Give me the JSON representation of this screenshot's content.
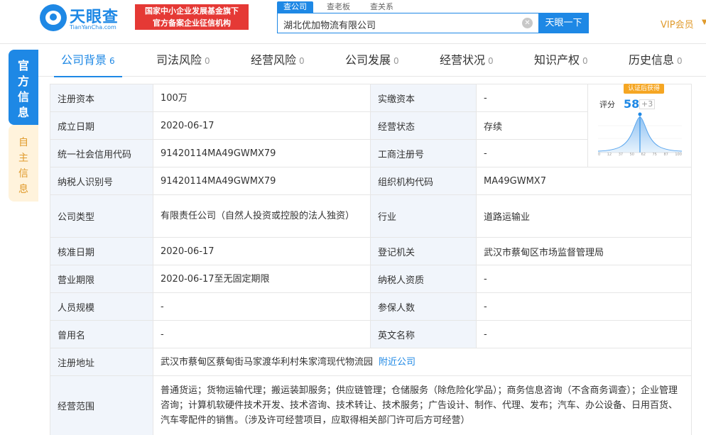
{
  "header": {
    "logo_cn": "天眼查",
    "logo_en": "TianYanCha.com",
    "slogan_line1": "国家中小企业发展基金旗下",
    "slogan_line2": "官方备案企业征信机构",
    "search_tabs": [
      "查公司",
      "查老板",
      "查关系"
    ],
    "search_value": "湖北优加物流有限公司",
    "search_button": "天眼一下",
    "vip": "VIP会员"
  },
  "side_tabs": {
    "official": [
      "官",
      "方",
      "信",
      "息"
    ],
    "self": [
      "自",
      "主",
      "信",
      "息"
    ]
  },
  "nav": [
    {
      "label": "公司背景",
      "count": "6"
    },
    {
      "label": "司法风险",
      "count": "0"
    },
    {
      "label": "经营风险",
      "count": "0"
    },
    {
      "label": "公司发展",
      "count": "0"
    },
    {
      "label": "经营状况",
      "count": "0"
    },
    {
      "label": "知识产权",
      "count": "0"
    },
    {
      "label": "历史信息",
      "count": "0"
    }
  ],
  "score": {
    "badge": "认证后获得",
    "label": "评分",
    "value": "58",
    "plus": "+3",
    "ticks": [
      "0",
      "12",
      "37",
      "50",
      "62",
      "75",
      "87",
      "100"
    ]
  },
  "info": {
    "r1": {
      "k1": "注册资本",
      "v1": "100万",
      "k2": "实缴资本",
      "v2": "-"
    },
    "r2": {
      "k1": "成立日期",
      "v1": "2020-06-17",
      "k2": "经营状态",
      "v2": "存续"
    },
    "r3": {
      "k1": "统一社会信用代码",
      "v1": "91420114MA49GWMX79",
      "k2": "工商注册号",
      "v2": "-"
    },
    "r4": {
      "k1": "纳税人识别号",
      "v1": "91420114MA49GWMX79",
      "k2": "组织机构代码",
      "v2": "MA49GWMX7"
    },
    "r5": {
      "k1": "公司类型",
      "v1": "有限责任公司（自然人投资或控股的法人独资）",
      "k2": "行业",
      "v2": "道路运输业"
    },
    "r6": {
      "k1": "核准日期",
      "v1": "2020-06-17",
      "k2": "登记机关",
      "v2": "武汉市蔡甸区市场监督管理局"
    },
    "r7": {
      "k1": "营业期限",
      "v1": "2020-06-17至无固定期限",
      "k2": "纳税人资质",
      "v2": "-"
    },
    "r8": {
      "k1": "人员规模",
      "v1": "-",
      "k2": "参保人数",
      "v2": "-"
    },
    "r9": {
      "k1": "曾用名",
      "v1": "-",
      "k2": "英文名称",
      "v2": "-"
    },
    "r10": {
      "k1": "注册地址",
      "v1": "武汉市蔡甸区蔡甸街马家渡华利村朱家湾现代物流园",
      "link": "附近公司"
    },
    "r11": {
      "k1": "经营范围",
      "v1": "普通货运；货物运输代理；搬运装卸服务；供应链管理；仓储服务（除危险化学品）；商务信息咨询（不含商务调查）；企业管理咨询；计算机软硬件技术开发、技术咨询、技术转让、技术服务；广告设计、制作、代理、发布；汽车、办公设备、日用百货、汽车零配件的销售。（涉及许可经营项目，应取得相关部门许可后方可经营）"
    }
  }
}
